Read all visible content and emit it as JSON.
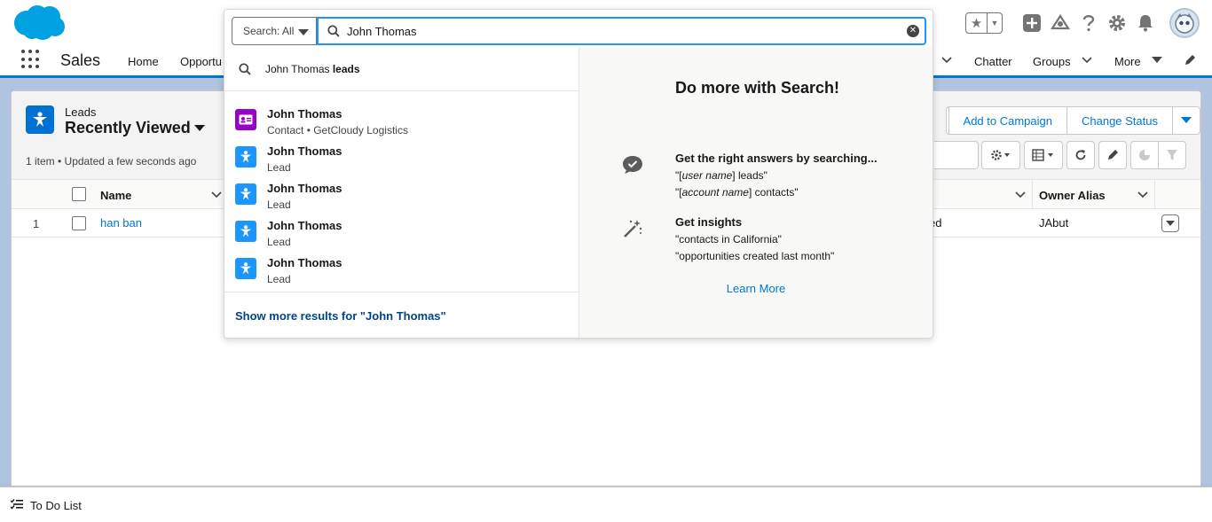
{
  "app": {
    "name": "Sales"
  },
  "nav": {
    "items": [
      "Home",
      "Opportu",
      "Chatter",
      "Groups",
      "More"
    ]
  },
  "list": {
    "object_label": "Leads",
    "view_name": "Recently Viewed",
    "meta": "1 item • Updated a few seconds ago",
    "buttons": [
      "Add to Campaign",
      "Change Status"
    ],
    "columns": {
      "name": "Name",
      "owner_alias": "Owner Alias"
    },
    "rows": [
      {
        "num": "1",
        "name": "han ban",
        "status_tail": "ed",
        "owner": "JAbut"
      }
    ]
  },
  "search": {
    "scope": "Search: All",
    "query": "John Thomas",
    "suggestion": {
      "prefix": "John Thomas",
      "bold": "leads"
    },
    "results": [
      {
        "title": "John Thomas",
        "subtitle": "Contact • GetCloudy Logistics",
        "type": "contact"
      },
      {
        "title": "John Thomas",
        "subtitle": "Lead",
        "type": "lead"
      },
      {
        "title": "John Thomas",
        "subtitle": "Lead",
        "type": "lead"
      },
      {
        "title": "John Thomas",
        "subtitle": "Lead",
        "type": "lead"
      },
      {
        "title": "John Thomas",
        "subtitle": "Lead",
        "type": "lead"
      }
    ],
    "show_more": "Show more results for \"John Thomas\"",
    "tips": {
      "title": "Do more with Search!",
      "h1": "Get the right answers by searching...",
      "t1_a_q1": "\"[",
      "t1_a_em": "user name",
      "t1_a_rest": "] leads\"",
      "t1_b_q1": "\"[",
      "t1_b_em": "account name",
      "t1_b_rest": "] contacts\"",
      "h2": "Get insights",
      "t2_a": "\"contacts in California\"",
      "t2_b": "\"opportunities created last month\"",
      "learn_more": "Learn More"
    }
  },
  "utility": {
    "todo": "To Do List"
  },
  "colors": {
    "brand": "#0176d3",
    "lead": "#1b96ff",
    "contact": "#9602c7",
    "link_dark": "#014486"
  }
}
